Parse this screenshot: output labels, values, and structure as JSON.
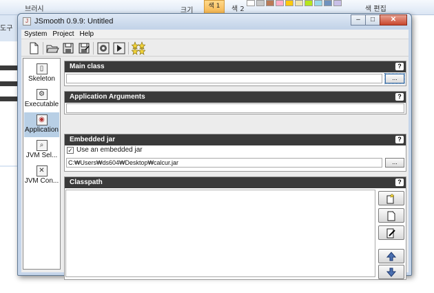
{
  "background_app": {
    "ribbon_labels": [
      "브러시",
      "크기",
      "색 1",
      "색 2",
      "색 편집"
    ],
    "side_label": "도구"
  },
  "window": {
    "title": "JSmooth 0.9.9: Untitled",
    "controls": {
      "minimize": "–",
      "maximize": "□",
      "close": "✕"
    }
  },
  "menu": [
    "System",
    "Project",
    "Help"
  ],
  "toolbar": {
    "buttons": [
      "new-icon",
      "open-folder-icon",
      "save-icon",
      "save-as-icon",
      "settings-gear-icon",
      "run-icon",
      "wizard-stars-icon"
    ]
  },
  "sidebar": {
    "items": [
      {
        "label": "Skeleton",
        "icon": "skeleton-icon"
      },
      {
        "label": "Executable",
        "icon": "executable-gear-icon"
      },
      {
        "label": "Application",
        "icon": "application-icon",
        "selected": true
      },
      {
        "label": "JVM Sel...",
        "icon": "jvm-selection-icon"
      },
      {
        "label": "JVM Con...",
        "icon": "jvm-configuration-icon"
      }
    ]
  },
  "panels": {
    "main_class": {
      "title": "Main class",
      "value": "",
      "browse_label": "...",
      "help": "?"
    },
    "app_args": {
      "title": "Application Arguments",
      "value": "",
      "help": "?"
    },
    "embedded_jar": {
      "title": "Embedded jar",
      "checkbox_label": "Use an embedded jar",
      "checked": true,
      "path": "C:₩Users₩ds604₩Desktop₩calcur.jar",
      "browse_label": "...",
      "help": "?"
    },
    "classpath": {
      "title": "Classpath",
      "help": "?",
      "buttons": [
        "add-folder-icon",
        "add-file-icon",
        "edit-icon",
        "move-up-icon",
        "move-down-icon"
      ]
    }
  },
  "colors": {
    "panel_header": "#3a3a3a",
    "window_frame": "#c5d5ea",
    "selected_item": "#b8cfe5",
    "close_button": "#c9462c"
  }
}
